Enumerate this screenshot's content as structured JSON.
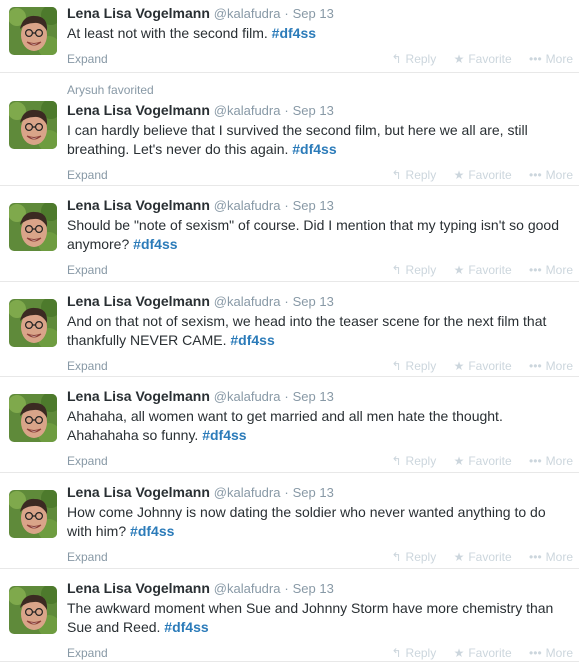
{
  "icons": {
    "reply": "reply-icon",
    "favorite": "star-icon",
    "more": "ellipsis-icon"
  },
  "colors": {
    "hashtag": "#2b7bb9",
    "muted": "#8899a6",
    "action": "#ccd6dd"
  },
  "tweets": [
    {
      "context": "",
      "name": "Lena Lisa Vogelmann",
      "handle": "@kalafudra",
      "dot": "·",
      "time": "Sep 13",
      "text": "At least not with the second film.",
      "hashtag": "#df4ss",
      "expand": "Expand",
      "reply": "Reply",
      "favorite": "Favorite",
      "more": "More"
    },
    {
      "context": "Arysuh favorited",
      "name": "Lena Lisa Vogelmann",
      "handle": "@kalafudra",
      "dot": "·",
      "time": "Sep 13",
      "text": "I can hardly believe that I survived the second film, but here we all are, still breathing. Let's never do this again.",
      "hashtag": "#df4ss",
      "expand": "Expand",
      "reply": "Reply",
      "favorite": "Favorite",
      "more": "More"
    },
    {
      "context": "",
      "name": "Lena Lisa Vogelmann",
      "handle": "@kalafudra",
      "dot": "·",
      "time": "Sep 13",
      "text": "Should be \"note of sexism\" of course. Did I mention that my typing isn't so good anymore?",
      "hashtag": "#df4ss",
      "expand": "Expand",
      "reply": "Reply",
      "favorite": "Favorite",
      "more": "More"
    },
    {
      "context": "",
      "name": "Lena Lisa Vogelmann",
      "handle": "@kalafudra",
      "dot": "·",
      "time": "Sep 13",
      "text": "And on that not of sexism, we head into the teaser scene for the next film that thankfully NEVER CAME.",
      "hashtag": "#df4ss",
      "expand": "Expand",
      "reply": "Reply",
      "favorite": "Favorite",
      "more": "More"
    },
    {
      "context": "",
      "name": "Lena Lisa Vogelmann",
      "handle": "@kalafudra",
      "dot": "·",
      "time": "Sep 13",
      "text": "Ahahaha, all women want to get married and all men hate the thought. Ahahahaha so funny.",
      "hashtag": "#df4ss",
      "expand": "Expand",
      "reply": "Reply",
      "favorite": "Favorite",
      "more": "More"
    },
    {
      "context": "",
      "name": "Lena Lisa Vogelmann",
      "handle": "@kalafudra",
      "dot": "·",
      "time": "Sep 13",
      "text": "How come Johnny is now dating the soldier who never wanted anything to do with him?",
      "hashtag": "#df4ss",
      "expand": "Expand",
      "reply": "Reply",
      "favorite": "Favorite",
      "more": "More"
    },
    {
      "context": "",
      "name": "Lena Lisa Vogelmann",
      "handle": "@kalafudra",
      "dot": "·",
      "time": "Sep 13",
      "text": "The awkward moment when Sue and Johnny Storm have more chemistry than Sue and Reed.",
      "hashtag": "#df4ss",
      "expand": "Expand",
      "reply": "Reply",
      "favorite": "Favorite",
      "more": "More"
    }
  ]
}
